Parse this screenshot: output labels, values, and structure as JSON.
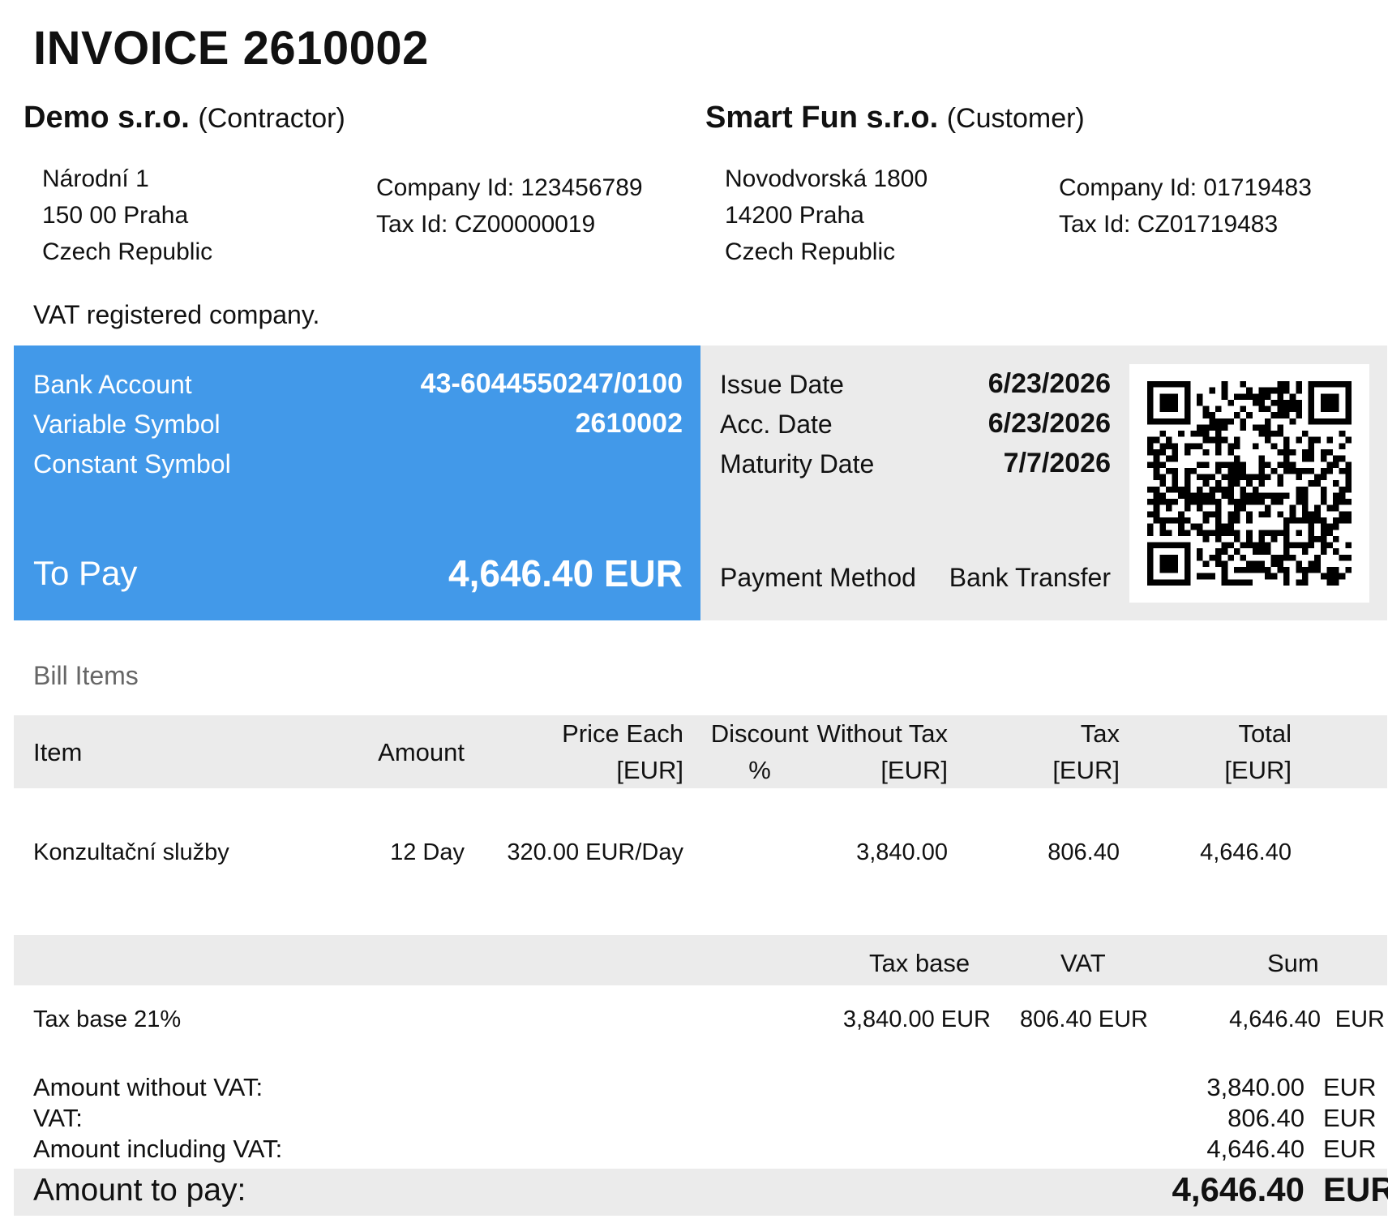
{
  "invoice": {
    "title": "INVOICE 2610002"
  },
  "contractor": {
    "name": "Demo s.r.o.",
    "role": "(Contractor)",
    "address": [
      "Národní 1",
      "150 00 Praha",
      "Czech Republic"
    ],
    "company_id": "Company Id: 123456789",
    "tax_id": "Tax Id: CZ00000019",
    "vat_note": "VAT registered company."
  },
  "customer": {
    "name": "Smart Fun s.r.o.",
    "role": "(Customer)",
    "address": [
      "Novodvorská 1800",
      "14200 Praha",
      "Czech Republic"
    ],
    "company_id": "Company Id: 01719483",
    "tax_id": "Tax Id: CZ01719483"
  },
  "payment": {
    "bank_account_label": "Bank Account",
    "bank_account_value": "43-6044550247/0100",
    "variable_symbol_label": "Variable Symbol",
    "variable_symbol_value": "2610002",
    "constant_symbol_label": "Constant Symbol",
    "to_pay_label": "To Pay",
    "to_pay_value": "4,646.40 EUR"
  },
  "dates": {
    "issue_label": "Issue Date",
    "issue_value": "6/23/2026",
    "acc_label": "Acc. Date",
    "acc_value": "6/23/2026",
    "maturity_label": "Maturity Date",
    "maturity_value": "7/7/2026",
    "method_label": "Payment Method",
    "method_value": "Bank Transfer"
  },
  "bill_items": {
    "section_title": "Bill Items",
    "headers": {
      "item": "Item",
      "amount": "Amount",
      "price_each_1": "Price Each",
      "price_each_2": "[EUR]",
      "discount_1": "Discount",
      "discount_2": "%",
      "without_tax_1": "Without Tax",
      "without_tax_2": "[EUR]",
      "tax_1": "Tax",
      "tax_2": "[EUR]",
      "total_1": "Total",
      "total_2": "[EUR]"
    },
    "rows": [
      {
        "item": "Konzultační služby",
        "amount": "12 Day",
        "price_each": "320.00 EUR/Day",
        "discount": "",
        "without_tax": "3,840.00",
        "tax": "806.40",
        "total": "4,646.40"
      }
    ]
  },
  "tax_summary": {
    "headers": {
      "tax_base": "Tax base",
      "vat": "VAT",
      "sum": "Sum"
    },
    "rows": [
      {
        "label": "Tax base 21%",
        "tax_base": "3,840.00 EUR",
        "vat": "806.40 EUR",
        "sum_value": "4,646.40",
        "sum_currency": "EUR"
      }
    ]
  },
  "totals": {
    "without_vat_label": "Amount without VAT:",
    "without_vat_value": "3,840.00",
    "vat_label": "VAT:",
    "vat_value": "806.40",
    "including_vat_label": "Amount including VAT:",
    "including_vat_value": "4,646.40",
    "currency": "EUR",
    "to_pay_label": "Amount to pay:",
    "to_pay_value": "4,646.40",
    "to_pay_currency": "EUR"
  }
}
